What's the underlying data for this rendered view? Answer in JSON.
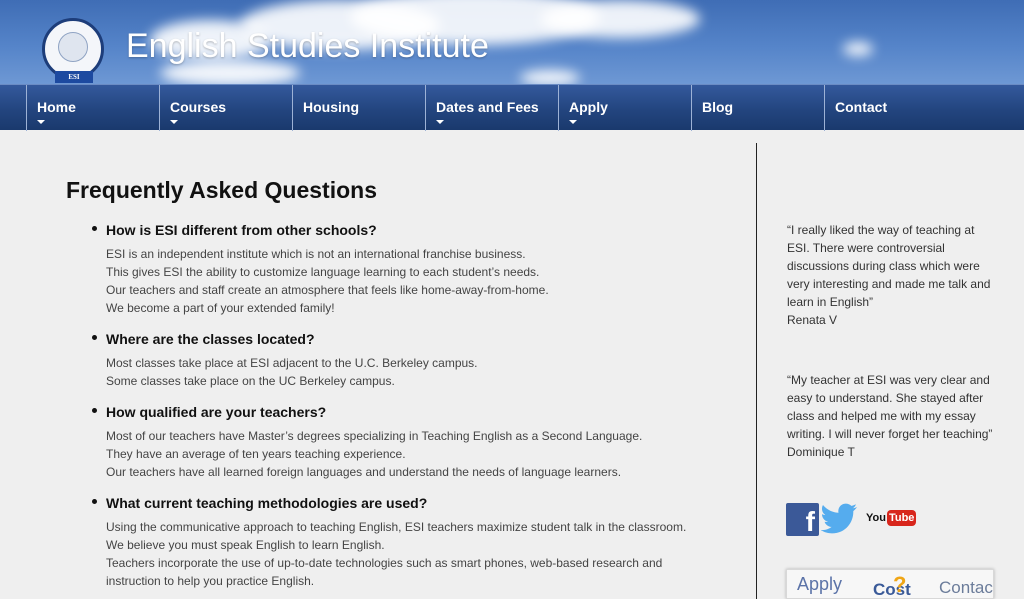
{
  "header": {
    "site_title": "English Studies Institute",
    "logo_ribbon_text": "ESI"
  },
  "nav": {
    "items": [
      {
        "label": "Home",
        "has_dropdown": true
      },
      {
        "label": "Courses",
        "has_dropdown": true
      },
      {
        "label": "Housing",
        "has_dropdown": false
      },
      {
        "label": "Dates and Fees",
        "has_dropdown": true
      },
      {
        "label": "Apply",
        "has_dropdown": true
      },
      {
        "label": "Blog",
        "has_dropdown": false
      },
      {
        "label": "Contact",
        "has_dropdown": false
      }
    ]
  },
  "main": {
    "title": "Frequently Asked Questions",
    "faqs": [
      {
        "question": "How is ESI different from other schools?",
        "answer": [
          "ESI is an independent institute which is not an international franchise business.",
          "This gives ESI the ability to customize language learning to each student’s needs.",
          "Our teachers and staff create an atmosphere that feels like home-away-from-home.",
          "We become a part of your extended family!"
        ]
      },
      {
        "question": "Where are the classes located?",
        "answer": [
          "Most classes take place at ESI adjacent to the U.C. Berkeley campus.",
          "Some classes take place on the UC Berkeley campus."
        ]
      },
      {
        "question": "How qualified are your teachers?",
        "answer": [
          "Most of our teachers have Master’s degrees specializing in Teaching English as a Second Language.",
          "They have an average of ten years teaching experience.",
          "Our teachers have all learned foreign languages and understand the needs of language learners."
        ]
      },
      {
        "question": "What current teaching methodologies are used?",
        "answer": [
          "Using the communicative approach to teaching English, ESI teachers maximize student talk in the classroom.",
          "We believe you must speak English to learn English.",
          "Teachers incorporate the use of up-to-date technologies such as smart phones, web-based research and",
          "instruction to help you practice English."
        ]
      }
    ]
  },
  "sidebar": {
    "testimonials": [
      {
        "quote_lines": [
          "“I really liked the way of teaching at",
          "ESI. There were controversial",
          "discussions during class which were",
          "very interesting and made me talk and",
          "learn in English”"
        ],
        "author": "Renata V"
      },
      {
        "quote_lines": [
          "“My teacher at ESI was very clear and",
          "easy to understand. She stayed after",
          "class and helped me with my essay",
          "writing. I will never forget her teaching”"
        ],
        "author": "Dominique T"
      }
    ],
    "social": {
      "facebook_glyph": "f",
      "youtube_you": "You",
      "youtube_tube": "Tube"
    },
    "promo": {
      "apply": "Apply",
      "cost": "Cost",
      "question_mark": "?",
      "contact": "Contact"
    }
  },
  "colors": {
    "header_sky": "#4f7fc4",
    "nav_bar": "#23457f",
    "page_bg": "#efefef",
    "facebook": "#3b5998",
    "twitter": "#55acee",
    "youtube_red": "#d8261c"
  }
}
